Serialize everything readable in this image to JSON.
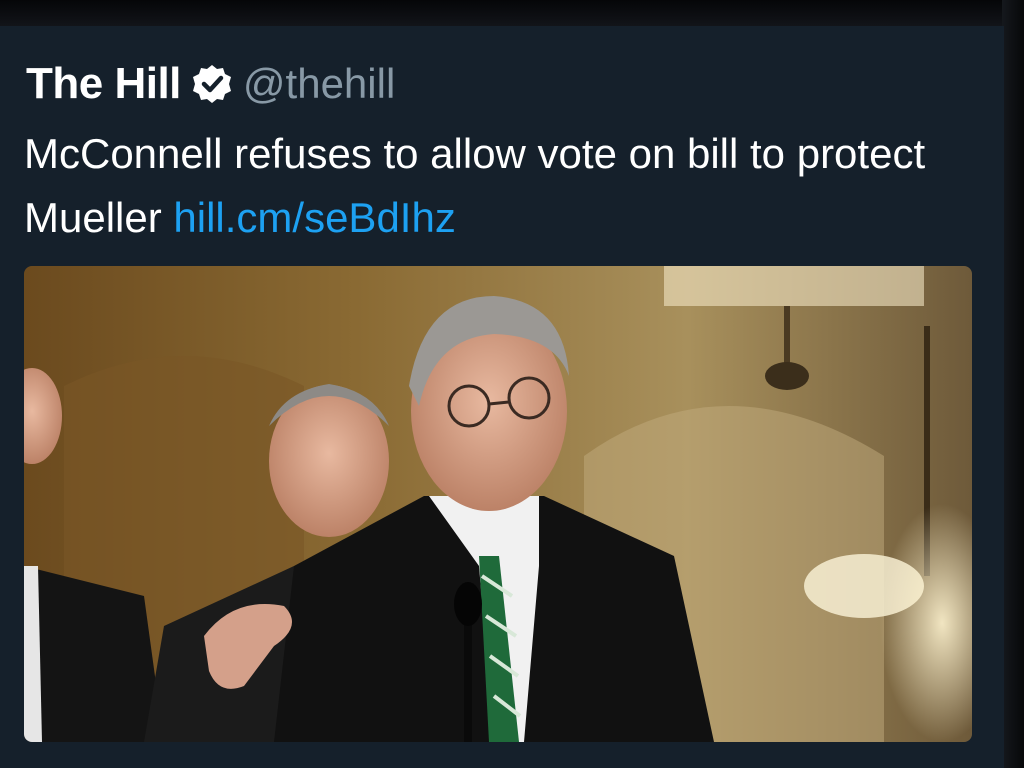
{
  "tweet": {
    "display_name": "The Hill",
    "verified_icon": "verified-badge-icon",
    "handle": "@thehill",
    "text": "McConnell refuses to allow vote on bill to protect Mueller ",
    "link": "hill.cm/seBdIhz"
  },
  "media": {
    "description_icon": "photo-image"
  },
  "colors": {
    "background": "#15202b",
    "text": "#ffffff",
    "handle": "#8899a6",
    "link": "#1da1f2"
  }
}
